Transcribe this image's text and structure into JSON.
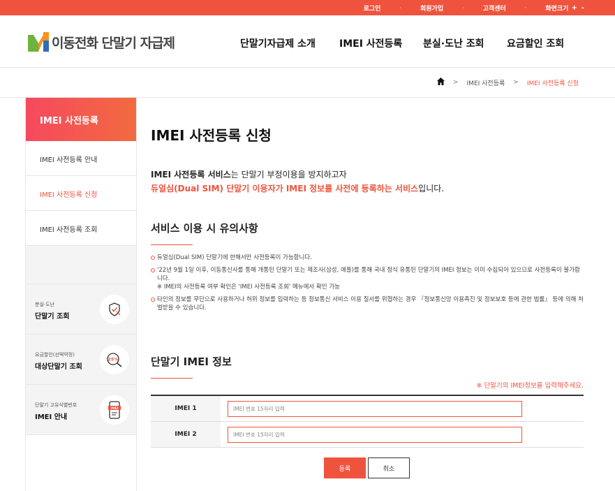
{
  "topbar": {
    "links": [
      "로그인",
      "회원가입",
      "고객센터"
    ],
    "font_size_label": "화면크기",
    "font_plus": "+",
    "font_minus": "-"
  },
  "header": {
    "logo_text": "이동전화 단말기 자급제",
    "nav": [
      "단말기자급제 소개",
      "IMEI 사전등록",
      "분실·도난 조회",
      "요금할인 조회"
    ]
  },
  "breadcrumb": {
    "items": [
      "IMEI 사전등록",
      "IMEI 사전등록 신청"
    ],
    "sep": ">"
  },
  "sidebar": {
    "title": "IMEI 사전등록",
    "items": [
      "IMEI 사전등록 안내",
      "IMEI 사전등록 신청",
      "IMEI 사전등록 조회"
    ],
    "cards": [
      {
        "small": "분실·도난",
        "big": "단말기 조회"
      },
      {
        "small": "요금할인(선택약정)",
        "big": "대상단말기 조회",
        "badge": "25%"
      },
      {
        "small": "단말기 고유식별번호",
        "big": "IMEI 안내",
        "badge": "IMEI"
      }
    ]
  },
  "main": {
    "title": "IMEI 사전등록 신청",
    "intro_bold": "IMEI 사전등록 서비스",
    "intro_rest": "는 단말기 부정이용을 방지하고자",
    "intro2_hl": "듀얼심(Dual SIM) 단말기 이용자가 IMEI 정보를 사전에 등록하는 서비스",
    "intro2_rest": "입니다.",
    "notice_title": "서비스 이용 시 유의사항",
    "notes": [
      "듀얼심(Dual SIM) 단말기에 한해서만 사전등록이 가능합니다.",
      "'22년 9월 1일 이후, 이동통신사를 통해 개통된 단말기 또는 제조사(삼성, 애플)를 통해 국내 정식 유통된 단말기의 IMEI 정보는 이미 수집되어 있으므로 사전등록이 불가합니다.",
      "※ IMEI의 사전등록 여부 확인은 'IMEI 사전등록 조회' 메뉴에서 확인 가능",
      "타인의 정보를 무단으로 사용하거나 허위 정보를 입력하는 등 정보통신 서비스 이용 질서를 위협하는 경우 『정보통신망 이용촉진 및 정보보호 등에 관한 법률』 등에 의해 처벌받을 수 있습니다."
    ],
    "imei_title": "단말기 IMEI 정보",
    "required_note": "※ 단말기의 IMEI정보를 입력해주세요.",
    "rows": [
      {
        "label": "IMEI 1",
        "placeholder": "IMEI 번호 15자리 입력"
      },
      {
        "label": "IMEI 2",
        "placeholder": "IMEI 번호 15자리 입력"
      }
    ],
    "submit_label": "등록",
    "cancel_label": "취소"
  },
  "colors": {
    "accent": "#f0533d",
    "logo_green": "#6cb33f",
    "logo_orange": "#f7931e",
    "logo_blue": "#2e6db4"
  }
}
